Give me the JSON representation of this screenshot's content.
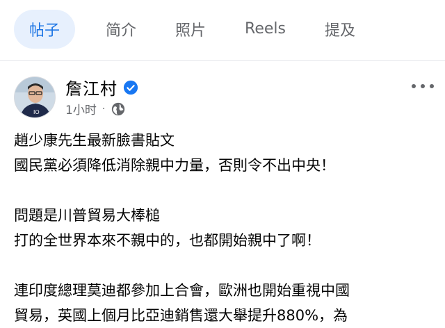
{
  "tabs": [
    {
      "label": "帖子",
      "active": true
    },
    {
      "label": "简介",
      "active": false
    },
    {
      "label": "照片",
      "active": false
    },
    {
      "label": "Reels",
      "active": false
    },
    {
      "label": "提及",
      "active": false
    }
  ],
  "post": {
    "author": "詹江村",
    "verified_icon": "verified-badge-icon",
    "time": "1小时",
    "separator": "·",
    "audience_icon": "globe-icon",
    "lines": [
      "趙少康先生最新臉書貼文",
      "國民黨必須降低消除親中力量，否則令不出中央！",
      "",
      "問題是川普貿易大棒槌",
      "打的全世界本來不親中的，也都開始親中了啊！",
      "",
      "連印度總理莫迪都參加上合會，歐洲也開始重視中國",
      "貿易，英國上個月比亞迪銷售還大舉提升880%，為"
    ]
  },
  "colors": {
    "accent": "#1b74e4",
    "active_tab_bg": "#e7f0fd",
    "secondary_text": "#65676b"
  }
}
